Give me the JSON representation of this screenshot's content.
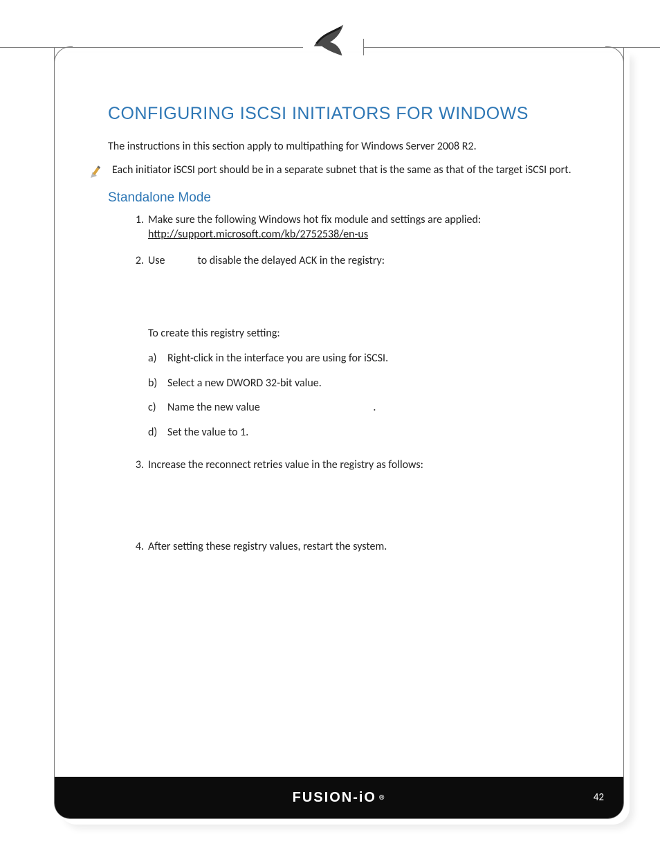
{
  "header": {
    "logo_name": "fusion-io-mark"
  },
  "section": {
    "title": "CONFIGURING ISCSI INITIATORS FOR WINDOWS",
    "intro": "The instructions in this section apply to multipathing for Windows Server 2008 R2.",
    "note": "Each initiator iSCSI port should be in a separate subnet that is the same as that of the target iSCSI port.",
    "subhead": "Standalone Mode",
    "steps": [
      {
        "n": "1.",
        "text_before_link": "Make sure the following Windows hot fix module and settings are applied: ",
        "link_text": "http://support.microsoft.com/kb/2752538/en-us",
        "link_href": "http://support.microsoft.com/kb/2752538/en-us"
      },
      {
        "n": "2.",
        "prefix": "Use ",
        "mid_gap": "            ",
        "suffix": "to disable the delayed ACK in the registry:",
        "reg_lead": "To create this registry setting:",
        "subs": [
          {
            "l": "a)",
            "t": "Right-click in the interface you are using for iSCSI."
          },
          {
            "l": "b)",
            "t": "Select a new DWORD 32-bit value."
          },
          {
            "l": "c)",
            "t_prefix": "Name the new value ",
            "t_suffix": "."
          },
          {
            "l": "d)",
            "t": "Set the value to 1."
          }
        ]
      },
      {
        "n": "3.",
        "text": "Increase the reconnect retries value in the registry as follows:"
      },
      {
        "n": "4.",
        "text": "After setting these registry values, restart the system."
      }
    ]
  },
  "footer": {
    "brand": "FUSION-iO",
    "page": "42"
  }
}
